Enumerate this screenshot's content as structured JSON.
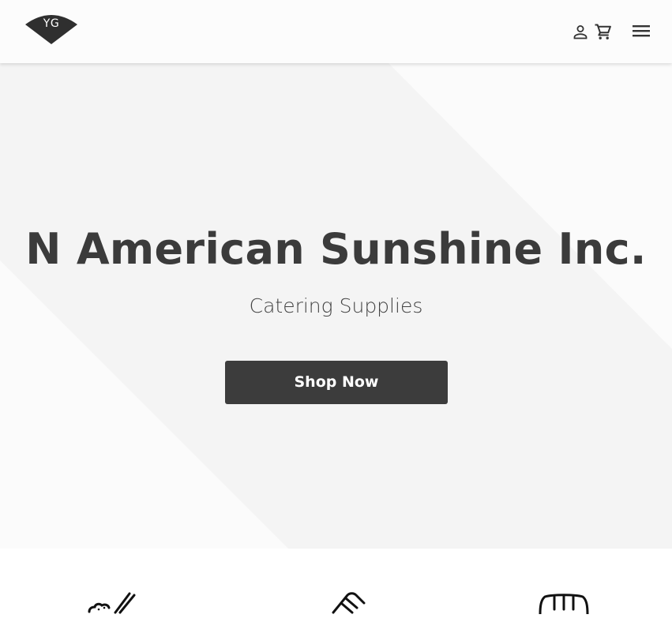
{
  "header": {
    "logo_text": "YG",
    "icons": {
      "account": "person-icon",
      "cart": "shopping-cart-icon",
      "menu": "hamburger-menu-icon"
    }
  },
  "hero": {
    "title": "N American Sunshine Inc.",
    "subtitle": "Catering Supplies",
    "cta_label": "Shop Now"
  },
  "categories": {
    "icons": [
      "bowl-chopsticks-icon",
      "takeout-container-icon",
      "food-tray-icon"
    ]
  },
  "colors": {
    "header_bg": "#fcfcfc",
    "hero_bg": "#f4f4f4",
    "hero_light": "#fbfbfb",
    "text_dark": "#3b3b3b",
    "button_bg": "#3c3c3c",
    "button_text": "#ffffff"
  }
}
